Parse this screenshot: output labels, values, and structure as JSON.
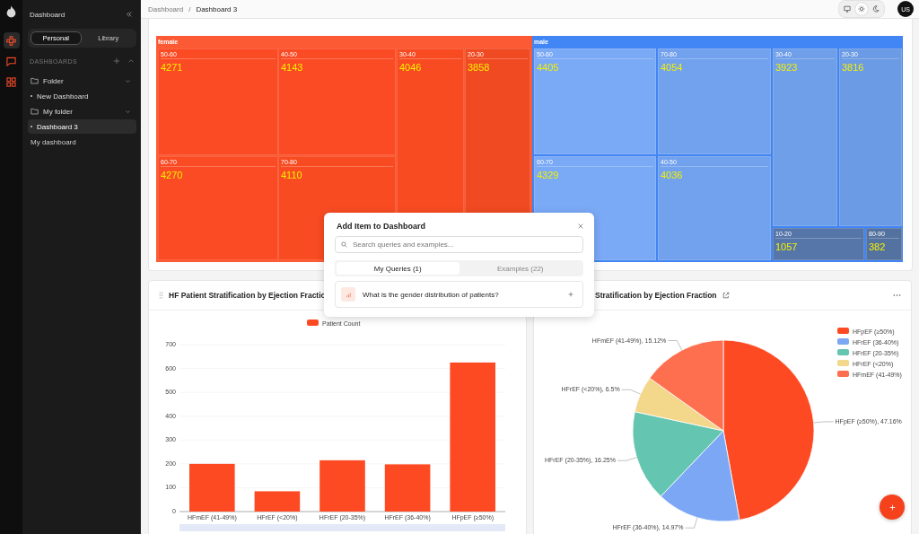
{
  "rail": {
    "items": [
      {
        "kind": "dashboards",
        "selected": true
      },
      {
        "kind": "chat",
        "selected": false
      },
      {
        "kind": "apps",
        "selected": false
      }
    ]
  },
  "sidebar": {
    "title": "Dashboard",
    "scope_tabs": [
      {
        "label": "Personal",
        "selected": true
      },
      {
        "label": "Library",
        "selected": false
      }
    ],
    "section": "DASHBOARDS",
    "items": [
      {
        "kind": "folder",
        "label": "Folder",
        "expanded": true,
        "children": [
          {
            "kind": "dashboard",
            "label": "New Dashboard",
            "selected": false
          }
        ]
      },
      {
        "kind": "folder",
        "label": "My folder",
        "expanded": true,
        "children": [
          {
            "kind": "dashboard",
            "label": "Dashboard 3",
            "selected": true
          }
        ]
      },
      {
        "kind": "dashboard",
        "label": "My dashboard",
        "selected": false
      }
    ]
  },
  "breadcrumb": {
    "items": [
      "Dashboard",
      "Dashboard 3"
    ],
    "separator": "/"
  },
  "theme_options": [
    {
      "kind": "system",
      "selected": false
    },
    {
      "kind": "light",
      "selected": true
    },
    {
      "kind": "dark",
      "selected": false
    }
  ],
  "avatar": "US",
  "treemap": {
    "groups": [
      {
        "label": "female",
        "color": "#fc5a35",
        "children": [
          {
            "label": "50-60",
            "value": "4271"
          },
          {
            "label": "40-50",
            "value": "4143"
          },
          {
            "label": "30-40",
            "value": "4046"
          },
          {
            "label": "20-30",
            "value": "3858"
          },
          {
            "label": "60-70",
            "value": "4270"
          },
          {
            "label": "70-80",
            "value": "4110"
          }
        ]
      },
      {
        "label": "male",
        "color": "#4285f4",
        "children": [
          {
            "label": "50-60",
            "value": "4405"
          },
          {
            "label": "70-80",
            "value": "4054"
          },
          {
            "label": "30-40",
            "value": "3923"
          },
          {
            "label": "20-30",
            "value": "3816"
          },
          {
            "label": "60-70",
            "value": "4329"
          },
          {
            "label": "40-50",
            "value": "4036"
          },
          {
            "label": "10-20",
            "value": "1057"
          },
          {
            "label": "80-90",
            "value": "382"
          }
        ]
      }
    ]
  },
  "bar_card": {
    "title": "HF Patient Stratification by Ejection Fractio",
    "chart_data": {
      "type": "bar",
      "categories": [
        "HFmEF (41-49%)",
        "HFrEF (<20%)",
        "HFrEF (20-35%)",
        "HFrEF (36-40%)",
        "HFpEF (≥50%)"
      ],
      "series": [
        {
          "name": "Patient Count",
          "color": "#fd4a23",
          "values": [
            200,
            85,
            215,
            198,
            625
          ]
        }
      ],
      "grid": true,
      "legend": "top",
      "ylim": [
        0,
        700
      ],
      "yticks": [
        0,
        100,
        200,
        300,
        400,
        500,
        600,
        700
      ]
    }
  },
  "pie_card": {
    "title": "Stratification by Ejection Fraction",
    "chart_data": {
      "type": "pie",
      "categories": [
        "HFpEF (≥50%)",
        "HFrEF (36-40%)",
        "HFrEF (20-35%)",
        "HFrEF (<20%)",
        "HFmEF (41-49%)"
      ],
      "values": [
        47.16,
        14.97,
        16.25,
        6.5,
        15.12
      ],
      "legend": "right",
      "colors": [
        "#fd4a23",
        "#7ba7f5",
        "#64c5b1",
        "#f3d78a",
        "#fd6f4f"
      ],
      "value_labels": [
        "HFpEF (≥50%), 47.16%",
        "HFrEF (36-40%), 14.97%",
        "HFrEF (20-35%), 16.25%",
        "HFrEF (<20%), 6.5%",
        "HFmEF (41-49%), 15.12%"
      ]
    }
  },
  "modal": {
    "title": "Add Item to Dashboard",
    "search": {
      "placeholder": "Search queries and examples..."
    },
    "tabs": [
      {
        "label": "My Queries (1)",
        "selected": true
      },
      {
        "label": "Examples (22)",
        "selected": false
      }
    ],
    "queries": [
      {
        "text": "What is the gender distribution of patients?"
      }
    ]
  }
}
